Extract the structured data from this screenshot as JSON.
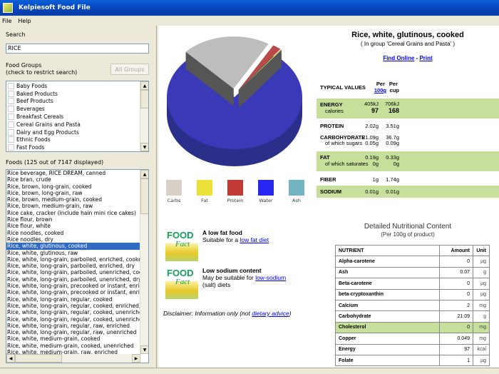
{
  "window": {
    "title": "Kelpiesoft Food File"
  },
  "menu": [
    "File",
    "Help"
  ],
  "search": {
    "label": "Search",
    "value": "RICE"
  },
  "groups": {
    "label1": "Food Groups",
    "label2": "(check to restrict search)",
    "all_button": "All Groups",
    "items": [
      "Baby Foods",
      "Baked Products",
      "Beef Products",
      "Beverages",
      "Breakfast Cereals",
      "Cereal Grains and Pasta",
      "Dairy and Egg Products",
      "Ethnic Foods",
      "Fast Foods"
    ]
  },
  "foods": {
    "label": "Foods (125 out of 7147 displayed)",
    "selected_index": 11,
    "items": [
      "Rice beverage, RICE DREAM, canned",
      "Rice bran, crude",
      "Rice, brown, long-grain, cooked",
      "Rice, brown, long-grain, raw",
      "Rice, brown, medium-grain, cooked",
      "Rice, brown, medium-grain, raw",
      "Rice cake, cracker (include hain mini rice cakes)",
      "Rice flour, brown",
      "Rice flour, white",
      "Rice noodles, cooked",
      "Rice noodles, dry",
      "Rice, white, glutinous, cooked",
      "Rice, white, glutinous, raw",
      "Rice, white, long-grain, parboiled, enriched, cooked",
      "Rice, white, long-grain, parboiled, enriched, dry",
      "Rice, white, long-grain, parboiled, unenriched, cooked",
      "Rice, white, long-grain, parboiled, unenriched, dry",
      "Rice, white, long-grain, precooked or instant, enriched",
      "Rice, white, long-grain, precooked or instant, enriched",
      "Rice, white, long-grain, regular, cooked",
      "Rice, white, long-grain, regular, cooked, enriched, with",
      "Rice, white, long-grain, regular, cooked, unenriched, w",
      "Rice, white, long-grain, regular, cooked, unenriched, w",
      "Rice, white, long-grain, regular, raw, enriched",
      "Rice, white, long-grain, regular, raw, unenriched",
      "Rice, white, medium-grain, cooked",
      "Rice, white, medium-grain, cooked, unenriched",
      "Rice, white, medium-grain, raw, enriched"
    ]
  },
  "food": {
    "title": "Rice, white, glutinous, cooked",
    "group": "( In group 'Cereal Grains and Pasta' )",
    "find_online": "Find Online",
    "sep": "-",
    "print": "Print"
  },
  "typical": {
    "header": "TYPICAL VALUES",
    "per": "Per",
    "per100": "100g",
    "cup": "cup",
    "energy": {
      "name": "ENERGY",
      "sub": "calories",
      "kj100": "405kJ",
      "kjcup": "706kJ",
      "cal100": "97",
      "calcup": "168"
    },
    "protein": {
      "name": "PROTEIN",
      "v100": "2.02g",
      "vcup": "3.51g"
    },
    "carb": {
      "name": "CARBOHYDRATE",
      "sub": "of which sugars",
      "v100": "21.09g",
      "vcup": "36.7g",
      "s100": "0.05g",
      "scup": "0.09g"
    },
    "fat": {
      "name": "FAT",
      "sub": "of which saturates",
      "v100": "0.19g",
      "vcup": "0.33g",
      "s100": "0g",
      "scup": "0g"
    },
    "fiber": {
      "name": "FIBER",
      "v100": "1g",
      "vcup": "1.74g"
    },
    "sodium": {
      "name": "SODIUM",
      "v100": "0.01g",
      "vcup": "0.01g"
    }
  },
  "pie": {
    "slices": [
      {
        "name": "Carbs",
        "value": 21.09,
        "color": "#bdbdbd"
      },
      {
        "name": "Protein",
        "value": 2.02,
        "color": "#b84a4a"
      },
      {
        "name": "Fat",
        "value": 0.19,
        "color": "#e6de2a"
      },
      {
        "name": "Ash",
        "value": 0.07,
        "color": "#6fb0bd"
      },
      {
        "name": "Water",
        "value": 76.63,
        "color": "#3a3ab8"
      }
    ]
  },
  "legend": [
    {
      "label": "Carbs",
      "color": "#d8d0c4"
    },
    {
      "label": "Fat",
      "color": "#ece03a"
    },
    {
      "label": "Protein",
      "color": "#c23a35"
    },
    {
      "label": "Water",
      "color": "#2828f0"
    },
    {
      "label": "Ash",
      "color": "#74b4c0"
    }
  ],
  "facts": [
    {
      "title": "A low fat food",
      "text": "Suitable for a ",
      "link": "low fat diet",
      "text2": ""
    },
    {
      "title": "Low sodium content",
      "text": "May be suitable for ",
      "link": "low-sodium",
      "text2": "(salt) diets"
    }
  ],
  "fact_img": {
    "word1": "FOOD",
    "word2": "Fact"
  },
  "disclaimer": {
    "text": "Disclaimer: Information only (not ",
    "link": "dietary advice",
    "end": ")"
  },
  "detailed": {
    "title": "Detailed Nutritional Content",
    "subtitle": "(Per 100g of product)",
    "headers": [
      "NUTRIENT",
      "Amount",
      "Unit"
    ],
    "rows": [
      [
        "Alpha-carotene",
        "0",
        "µg"
      ],
      [
        "Ash",
        "0.07",
        "g"
      ],
      [
        "Beta-carotene",
        "0",
        "µg"
      ],
      [
        "beta-cryptoxanthin",
        "0",
        "µg"
      ],
      [
        "Calcium",
        "2",
        "mg"
      ],
      [
        "Carbohydrate",
        "21.09",
        "g"
      ],
      [
        "Cholesterol",
        "0",
        "mg"
      ],
      [
        "Copper",
        "0.049",
        "mg"
      ],
      [
        "Energy",
        "97",
        "kcal"
      ],
      [
        "Folate",
        "1",
        "µg"
      ]
    ],
    "highlight_index": 6
  }
}
